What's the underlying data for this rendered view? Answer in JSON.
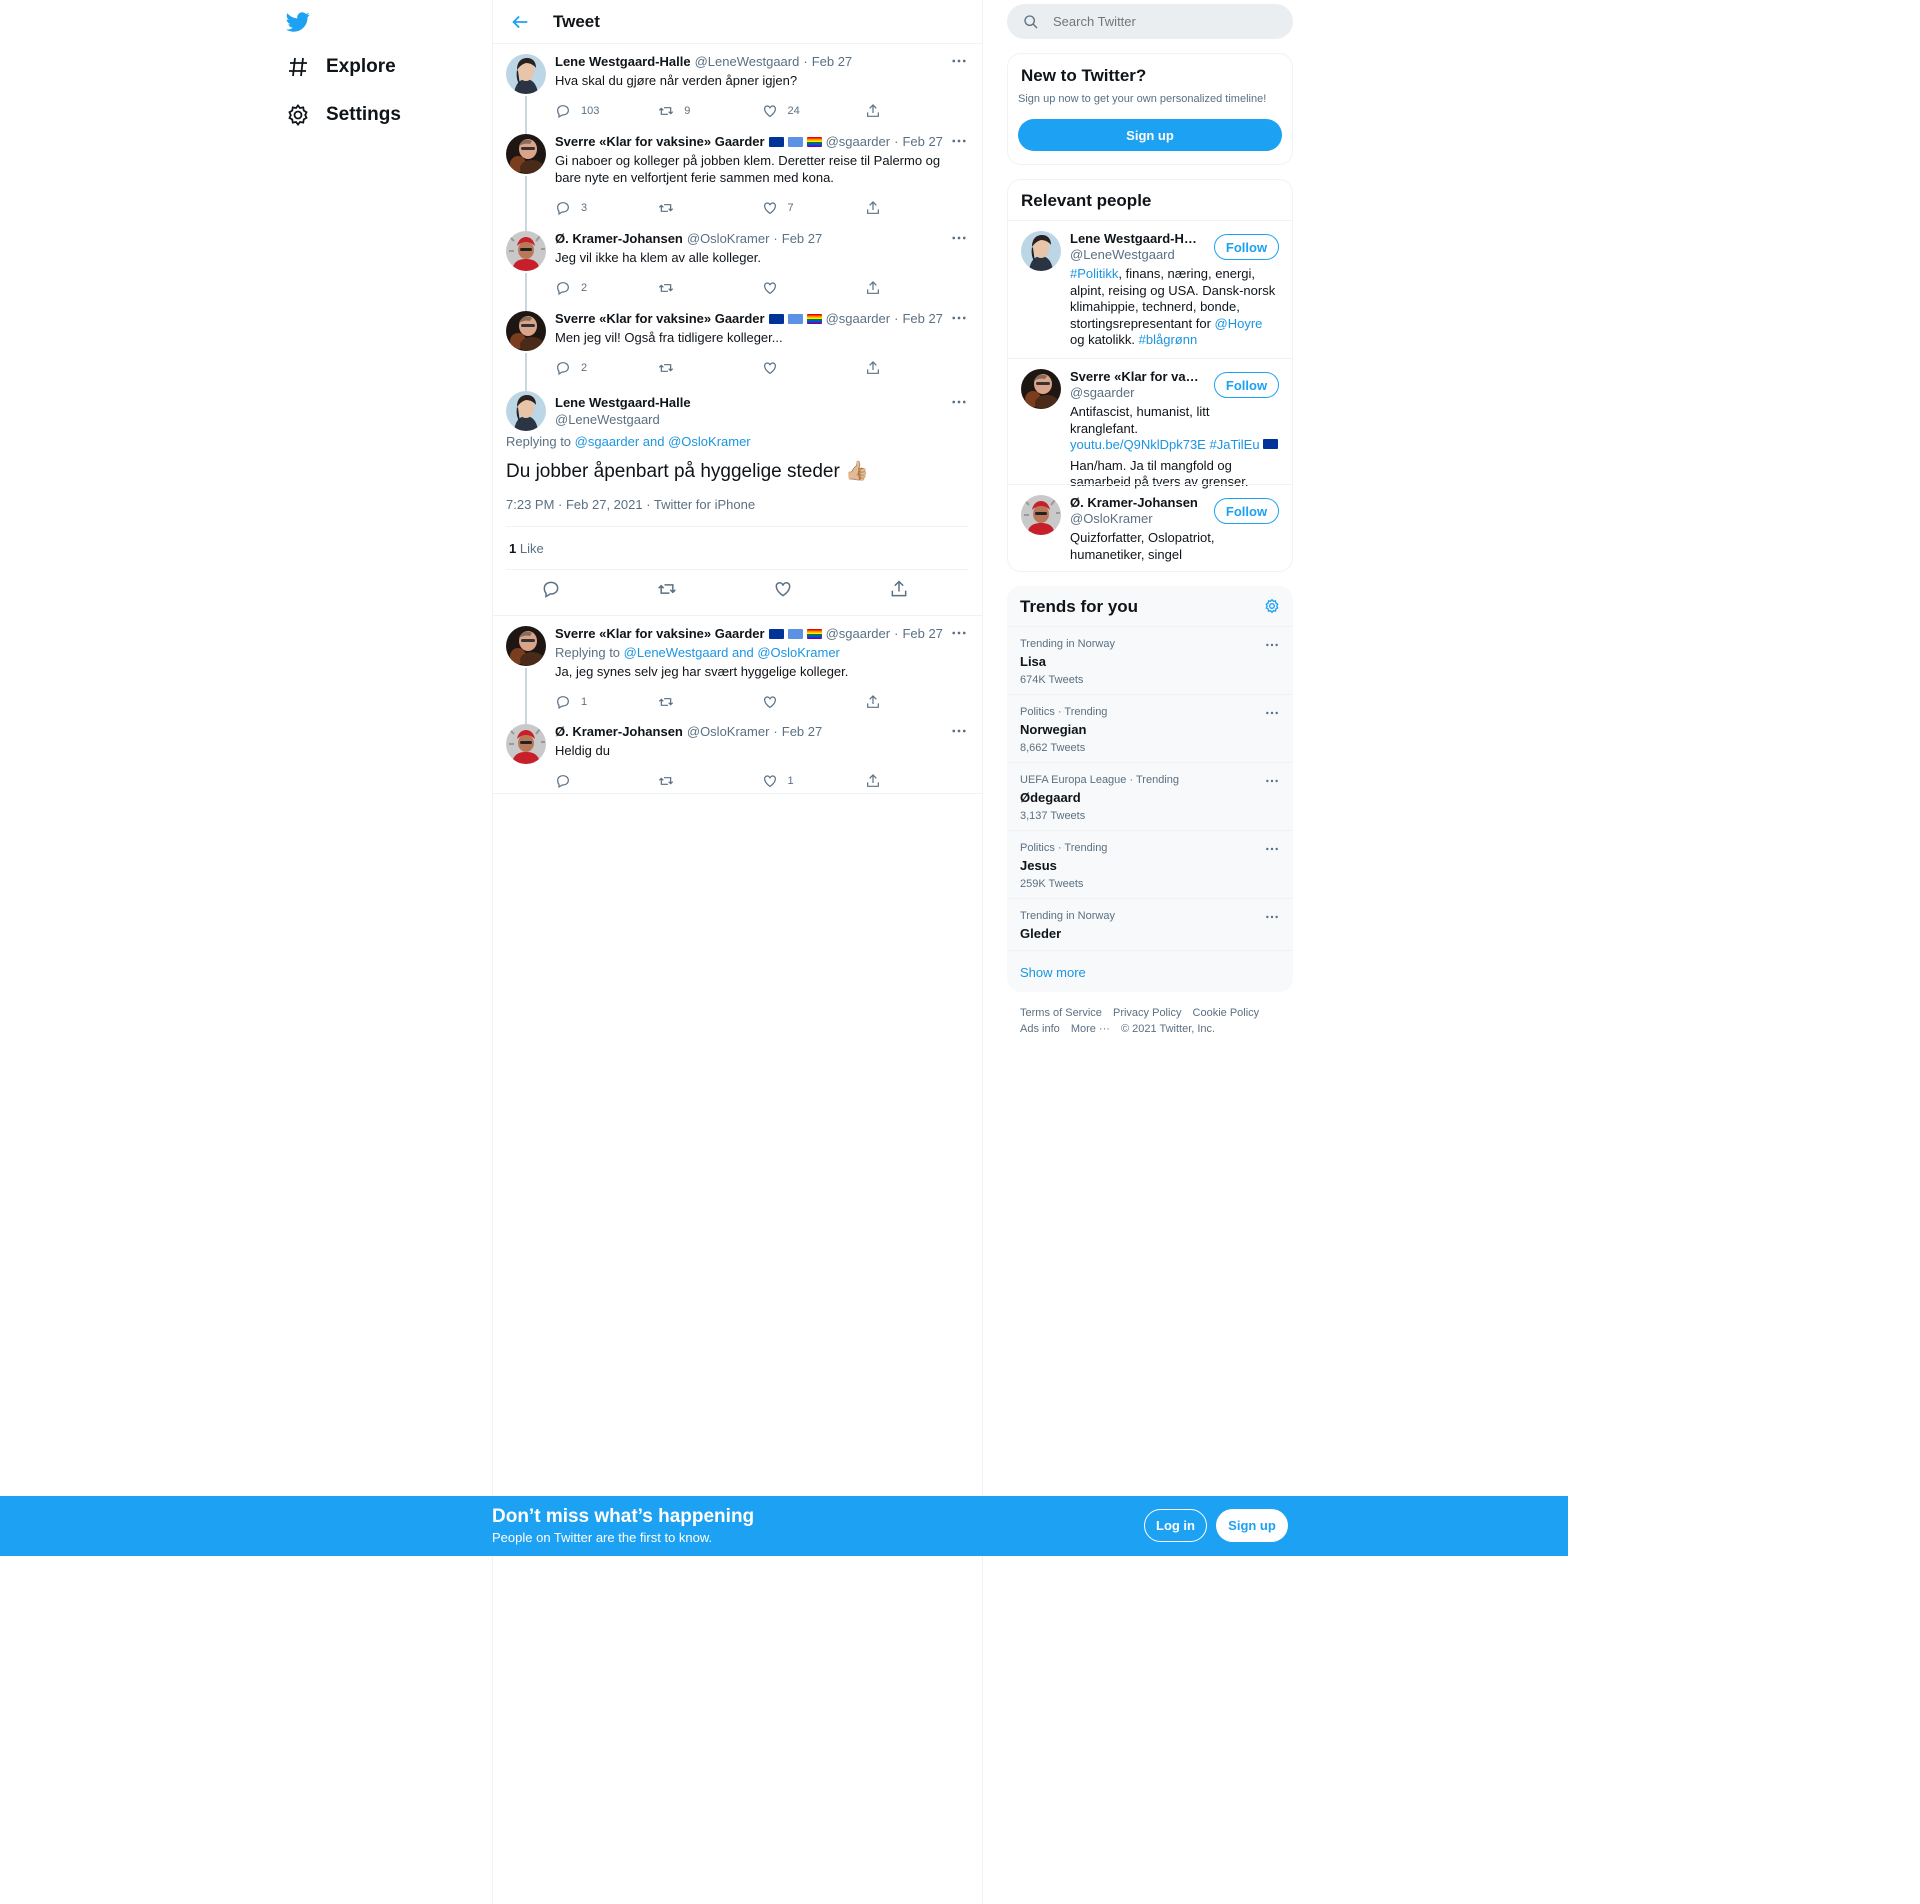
{
  "nav": {
    "items": [
      {
        "label": "Explore",
        "icon": "hash-icon"
      },
      {
        "label": "Settings",
        "icon": "gear-icon"
      }
    ]
  },
  "header": {
    "title": "Tweet"
  },
  "thread_before": [
    {
      "name": "Lene Westgaard-Halle",
      "handle": "@LeneWestgaard",
      "date": "Feb 27",
      "text": "Hva skal du gjøre når verden åpner igjen?",
      "replies": "103",
      "retweets": "9",
      "likes": "24",
      "flags": []
    },
    {
      "name": "Sverre «Klar for vaksine» Gaarder",
      "handle": "@sgaarder",
      "date": "Feb 27",
      "text": "Gi naboer og kolleger på jobben klem. Deretter reise til Palermo og bare nyte en velfortjent ferie sammen med kona.",
      "replies": "3",
      "retweets": "",
      "likes": "7",
      "flags": [
        "eu",
        "un",
        "pride"
      ]
    },
    {
      "name": "Ø. Kramer-Johansen",
      "handle": "@OsloKramer",
      "date": "Feb 27",
      "text": "Jeg vil ikke ha klem av alle kolleger.",
      "replies": "2",
      "retweets": "",
      "likes": "",
      "flags": []
    },
    {
      "name": "Sverre «Klar for vaksine» Gaarder",
      "handle": "@sgaarder",
      "date": "Feb 27",
      "text": "Men jeg vil! Også fra tidligere kolleger...",
      "replies": "2",
      "retweets": "",
      "likes": "",
      "flags": [
        "eu",
        "un",
        "pride"
      ]
    }
  ],
  "focused": {
    "name": "Lene Westgaard-Halle",
    "handle": "@LeneWestgaard",
    "replying_prefix": "Replying to",
    "replying_to": "@sgaarder and @OsloKramer",
    "text": "Du jobber åpenbart på hyggelige steder 👍🏼",
    "meta": "7:23 PM · Feb 27, 2021 · Twitter for iPhone",
    "like_count": "1",
    "like_label": "Like"
  },
  "thread_after": [
    {
      "name": "Sverre «Klar for vaksine» Gaarder",
      "handle": "@sgaarder",
      "date": "Feb 27",
      "replying_prefix": "Replying to",
      "replying_to": "@LeneWestgaard and @OsloKramer",
      "text": "Ja, jeg synes selv jeg har svært hyggelige kolleger.",
      "replies": "1",
      "retweets": "",
      "likes": "",
      "flags": [
        "eu",
        "un",
        "pride"
      ]
    },
    {
      "name": "Ø. Kramer-Johansen",
      "handle": "@OsloKramer",
      "date": "Feb 27",
      "replying_prefix": "",
      "replying_to": "",
      "text": "Heldig du",
      "replies": "",
      "retweets": "",
      "likes": "1",
      "flags": []
    }
  ],
  "search": {
    "placeholder": "Search Twitter"
  },
  "new_to_twitter": {
    "title": "New to Twitter?",
    "subtitle": "Sign up now to get your own personalized timeline!",
    "button": "Sign up"
  },
  "relevant": {
    "title": "Relevant people",
    "follow_label": "Follow",
    "people": [
      {
        "name": "Lene Westgaard-Halle",
        "handle": "@LeneWestgaard"
      },
      {
        "name": "Sverre «Klar for vaksine» Gaarder 🇪🇺 🇺🇳 🏳️‍🌈",
        "handle": "@sgaarder"
      },
      {
        "name": "Ø. Kramer-Johansen",
        "handle": "@OsloKramer",
        "bio": "Quizforfatter, Oslopatriot, humanetiker, singel"
      }
    ],
    "bio1": {
      "tag1": "#Politikk",
      "t1": ", finans, næring, energi, alpint, reising og USA. Dansk-norsk klimahippie, technerd, bonde, stortingsrepresentant for ",
      "mention": "@Hoyre",
      "t2": " og katolikk. ",
      "tag2": "#blågrønn"
    },
    "bio2": {
      "t1": "Antifascist, humanist, litt kranglefant.",
      "link": "youtu.be/Q9NklDpk73E",
      "tag": "#JaTilEu",
      "t2": "Han/ham. Ja til mangfold og samarbeid på tvers av grenser."
    }
  },
  "trends": {
    "title": "Trends for you",
    "items": [
      {
        "meta": "Trending in Norway",
        "name": "Lisa",
        "count": "674K Tweets"
      },
      {
        "meta": "Politics · Trending",
        "name": "Norwegian",
        "count": "8,662 Tweets"
      },
      {
        "meta": "UEFA Europa League · Trending",
        "name": "Ødegaard",
        "count": "3,137 Tweets"
      },
      {
        "meta": "Politics · Trending",
        "name": "Jesus",
        "count": "259K Tweets"
      },
      {
        "meta": "Trending in Norway",
        "name": "Gleder",
        "count": ""
      }
    ],
    "show_more": "Show more"
  },
  "footer": {
    "terms": "Terms of Service",
    "privacy": "Privacy Policy",
    "cookie": "Cookie Policy",
    "ads": "Ads info",
    "more": "More ···",
    "copyright": "© 2021 Twitter, Inc."
  },
  "bottom_bar": {
    "title": "Don’t miss what’s happening",
    "subtitle": "People on Twitter are the first to know.",
    "login": "Log in",
    "signup": "Sign up"
  },
  "colors": {
    "accent": "#1da1f2",
    "link": "#1b95e0",
    "muted": "#5b7083"
  }
}
